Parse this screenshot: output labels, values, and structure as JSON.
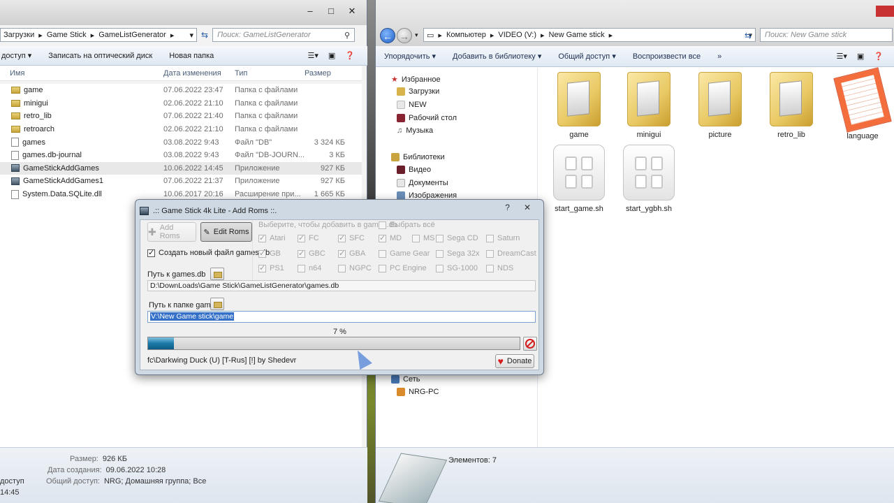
{
  "left_window": {
    "breadcrumb": [
      "Загрузки",
      "Game Stick",
      "GameListGenerator"
    ],
    "search_placeholder": "Поиск: GameListGenerator",
    "commands": [
      "доступ",
      "Записать на оптический диск",
      "Новая папка"
    ],
    "columns": [
      "Имя",
      "Дата изменения",
      "Тип",
      "Размер"
    ],
    "files": [
      {
        "name": "game",
        "date": "07.06.2022 23:47",
        "type": "Папка с файлами",
        "size": "",
        "icon": "folder-icon"
      },
      {
        "name": "minigui",
        "date": "02.06.2022 21:10",
        "type": "Папка с файлами",
        "size": "",
        "icon": "folder-icon"
      },
      {
        "name": "retro_lib",
        "date": "07.06.2022 21:40",
        "type": "Папка с файлами",
        "size": "",
        "icon": "folder-icon"
      },
      {
        "name": "retroarch",
        "date": "02.06.2022 21:10",
        "type": "Папка с файлами",
        "size": "",
        "icon": "folder-icon"
      },
      {
        "name": "games",
        "date": "03.08.2022 9:43",
        "type": "Файл \"DB\"",
        "size": "3 324 КБ",
        "icon": "file-icon"
      },
      {
        "name": "games.db-journal",
        "date": "03.08.2022 9:43",
        "type": "Файл \"DB-JOURN...",
        "size": "3 КБ",
        "icon": "file-icon"
      },
      {
        "name": "GameStickAddGames",
        "date": "10.06.2022 14:45",
        "type": "Приложение",
        "size": "927 КБ",
        "icon": "app-icon"
      },
      {
        "name": "GameStickAddGames1",
        "date": "07.06.2022 21:37",
        "type": "Приложение",
        "size": "927 КБ",
        "icon": "app-icon"
      },
      {
        "name": "System.Data.SQLite.dll",
        "date": "10.06.2017 20:16",
        "type": "Расширение при...",
        "size": "1 665 КБ",
        "icon": "dll-icon"
      }
    ],
    "details": {
      "size_label": "Размер:",
      "size_value": "926 КБ",
      "created_label": "Дата создания:",
      "created_value": "09.06.2022 10:28",
      "share_label": "Общий доступ:",
      "share_value": "NRG; Домашняя группа; Все",
      "left_trunc_1": "доступ",
      "left_trunc_2": "14:45"
    }
  },
  "right_window": {
    "breadcrumb": [
      "Компьютер",
      "VIDEO (V:)",
      "New Game stick"
    ],
    "search_placeholder": "Поиск: New Game stick",
    "commands": [
      "Упорядочить",
      "Добавить в библиотеку",
      "Общий доступ",
      "Воспроизвести все",
      "»"
    ],
    "nav": {
      "favorites": "Избранное",
      "downloads": "Загрузки",
      "new": "NEW",
      "desktop": "Рабочий стол",
      "music": "Музыка",
      "libraries": "Библиотеки",
      "video": "Видео",
      "documents": "Документы",
      "images": "Изображения",
      "network": "Сеть",
      "pc": "NRG-PC"
    },
    "items": [
      {
        "name": "game",
        "kind": "folder"
      },
      {
        "name": "minigui",
        "kind": "folder"
      },
      {
        "name": "picture",
        "kind": "folder"
      },
      {
        "name": "retro_lib",
        "kind": "folder"
      },
      {
        "name": "language",
        "kind": "document"
      },
      {
        "name": "start_game.sh",
        "kind": "script"
      },
      {
        "name": "start_ygbh.sh",
        "kind": "script"
      }
    ],
    "status": "Элементов: 7"
  },
  "dialog": {
    "title": ".:: Game Stick 4k Lite - Add Roms ::.",
    "help": "?",
    "close": "✕",
    "add_roms": "Add Roms",
    "edit_roms": "Edit Roms",
    "create_new_db": "Создать новый файл games.db",
    "select_hint": "Выберите, чтобы добавить в games.db",
    "select_all": "Выбрать всё",
    "platforms": [
      {
        "name": "Atari",
        "checked": true
      },
      {
        "name": "FC",
        "checked": true
      },
      {
        "name": "SFC",
        "checked": true
      },
      {
        "name": "MD",
        "checked": true
      },
      {
        "name": "MS",
        "checked": false
      },
      {
        "name": "Sega CD",
        "checked": false
      },
      {
        "name": "Saturn",
        "checked": false
      },
      {
        "name": "GB",
        "checked": true
      },
      {
        "name": "GBC",
        "checked": true
      },
      {
        "name": "GBA",
        "checked": true
      },
      {
        "name": "Game Gear",
        "checked": false
      },
      {
        "name": "Sega 32x",
        "checked": false
      },
      {
        "name": "DreamCast",
        "checked": false
      },
      {
        "name": "PS1",
        "checked": true
      },
      {
        "name": "n64",
        "checked": false
      },
      {
        "name": "NGPC",
        "checked": false
      },
      {
        "name": "PC Engine",
        "checked": false
      },
      {
        "name": "SG-1000",
        "checked": false
      },
      {
        "name": "NDS",
        "checked": false
      }
    ],
    "db_path_label": "Путь к games.db",
    "db_path": "D:\\DownLoads\\Game Stick\\GameListGenerator\\games.db",
    "game_folder_label": "Путь к папке game",
    "game_folder": "V:\\New Game stick\\game",
    "progress_text": "7 %",
    "progress": 0.07,
    "current_file": "fc\\Darkwing Duck (U) [T-Rus] [!] by Shedevr",
    "donate": "Donate"
  }
}
